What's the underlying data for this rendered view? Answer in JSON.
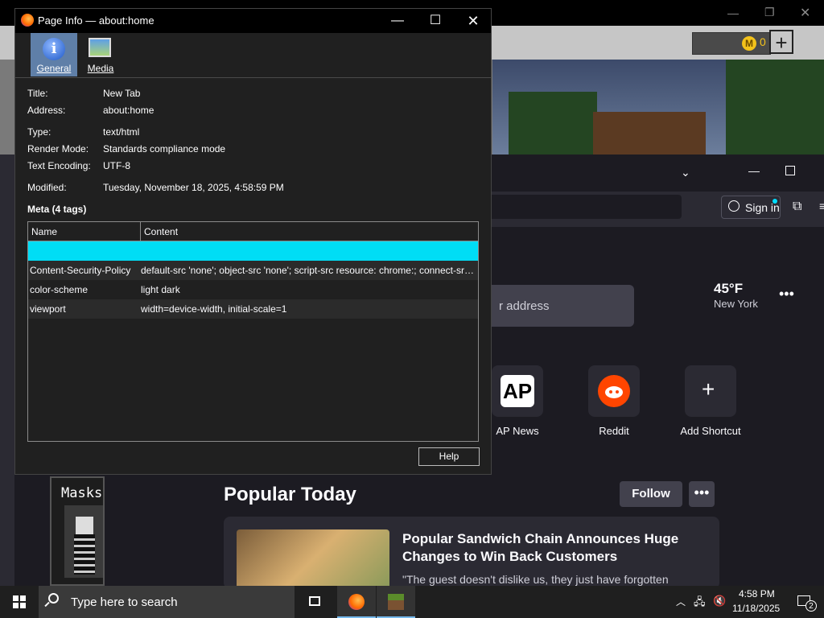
{
  "dialog": {
    "title": "Page Info — about:home",
    "tabs": [
      {
        "label": "General",
        "selected": true
      },
      {
        "label": "Media",
        "selected": false
      }
    ],
    "general": {
      "title_label": "Title:",
      "title_value": "New Tab",
      "address_label": "Address:",
      "address_value": "about:home",
      "type_label": "Type:",
      "type_value": "text/html",
      "render_label": "Render Mode:",
      "render_value": "Standards compliance mode",
      "encoding_label": "Text Encoding:",
      "encoding_value": "UTF-8",
      "modified_label": "Modified:",
      "modified_value": "Tuesday, November 18, 2025, 4:58:59 PM"
    },
    "meta_title": "Meta (4 tags)",
    "meta_columns": [
      "Name",
      "Content"
    ],
    "meta_rows": [
      {
        "name": "",
        "content": ""
      },
      {
        "name": "Content-Security-Policy",
        "content": "default-src 'none'; object-src 'none'; script-src resource: chrome:; connect-src..."
      },
      {
        "name": "color-scheme",
        "content": "light dark"
      },
      {
        "name": "viewport",
        "content": "width=device-width, initial-scale=1"
      }
    ],
    "help_label": "Help",
    "selection_color": "#00ddf5"
  },
  "browser": {
    "signin_label": "Sign in",
    "search_placeholder": "r address",
    "weather_temp": "45°F",
    "weather_location": "New York",
    "shortcuts": [
      {
        "label": "AP News",
        "icon": "ap-news-icon"
      },
      {
        "label": "Reddit",
        "icon": "reddit-icon"
      },
      {
        "label": "Add Shortcut",
        "icon": "plus-icon"
      }
    ],
    "ap_logo_text": "AP",
    "popular_title": "Popular Today",
    "follow_label": "Follow",
    "card_headline": "Popular Sandwich Chain Announces Huge Changes to Win Back Customers",
    "card_snippet": "\"The guest doesn't dislike us, they just have forgotten"
  },
  "game": {
    "coin_count": "0",
    "masks_label": "Masks"
  },
  "taskbar": {
    "search_placeholder": "Type here to search",
    "time": "4:58 PM",
    "date": "11/18/2025",
    "notification_count": "2"
  }
}
